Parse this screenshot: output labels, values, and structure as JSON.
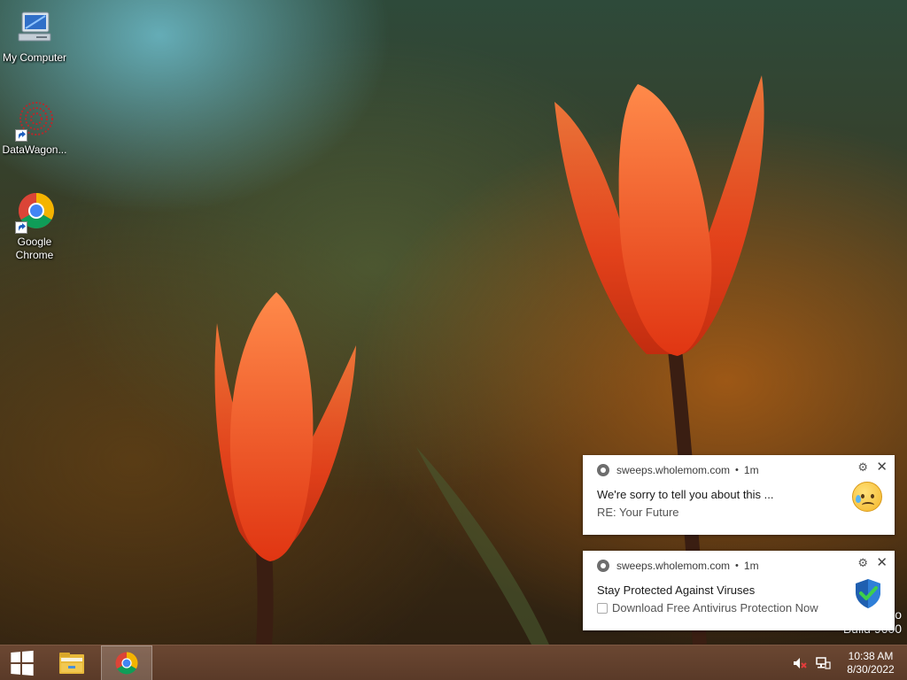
{
  "desktop": {
    "icons": [
      {
        "label": "My Computer"
      },
      {
        "label": "DataWagon..."
      },
      {
        "label": "Google Chrome"
      }
    ]
  },
  "notifications": [
    {
      "source": "sweeps.wholemom.com",
      "time": "1m",
      "title": "We're sorry to tell you about this ...",
      "body": "RE: Your Future",
      "thumb_icon": "sad-tear-emoji-icon"
    },
    {
      "source": "sweeps.wholemom.com",
      "time": "1m",
      "title": "Stay Protected Against Viruses",
      "body": "Download Free Antivirus Protection Now",
      "thumb_icon": "shield-check-icon"
    }
  ],
  "watermark": {
    "line1": "o",
    "line2": "Build 9600"
  },
  "taskbar": {
    "clock_time": "10:38 AM",
    "clock_date": "8/30/2022"
  },
  "colors": {
    "taskbar": "#5a3a28",
    "accent_tulip": "#f04a1a"
  }
}
